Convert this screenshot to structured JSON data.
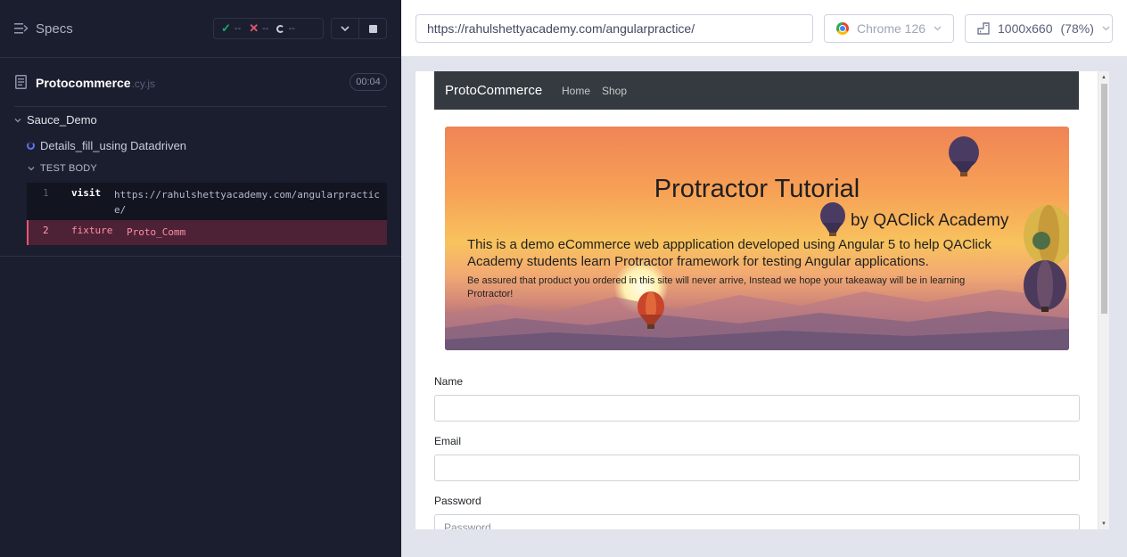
{
  "runner": {
    "specs_label": "Specs",
    "stats": {
      "passed": "--",
      "failed": "--",
      "pending": "--"
    },
    "file": {
      "name": "Protocommerce",
      "ext": ".cy.js",
      "duration": "00:04"
    },
    "suite": "Sauce_Demo",
    "test": "Details_fill_using Datadriven",
    "test_body": "TEST BODY",
    "commands": [
      {
        "num": "1",
        "name": "visit",
        "message": "https://rahulshettyacademy.com/angularpractice/"
      },
      {
        "num": "2",
        "name": "fixture",
        "message": "Proto_Comm"
      }
    ]
  },
  "browser": {
    "url": "https://rahulshettyacademy.com/angularpractice/",
    "browser_name": "Chrome 126",
    "viewport": "1000x660",
    "scale": "(78%)"
  },
  "app": {
    "brand": "ProtoCommerce",
    "nav": [
      "Home",
      "Shop"
    ],
    "hero": {
      "title": "Protractor Tutorial",
      "subtitle": "by QAClick Academy",
      "desc": "This is a demo eCommerce web appplication developed using Angular 5 to help QAClick Academy students learn Protractor framework for testing Angular applications.",
      "note": "Be assured that product you ordered in this site will never arrive, Instead we hope your takeaway will be in learning Protractor!"
    },
    "form": {
      "name_label": "Name",
      "email_label": "Email",
      "password_label": "Password",
      "password_placeholder": "Password"
    }
  }
}
